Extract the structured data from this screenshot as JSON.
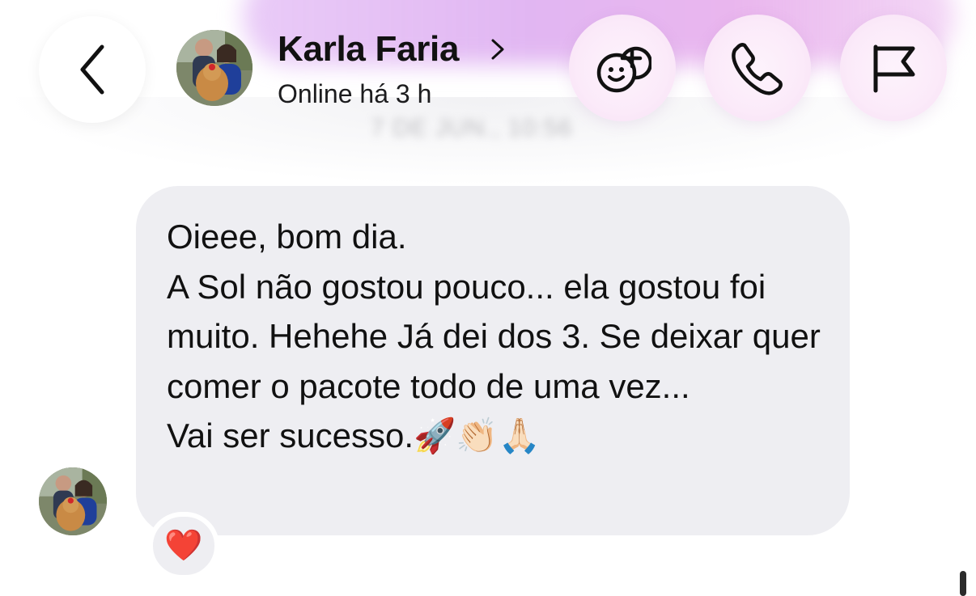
{
  "header": {
    "contact_name": "Karla Faria",
    "status": "Online há 3 h",
    "back_icon": "chevron-left-icon",
    "chevron_icon": "chevron-right-icon",
    "actions": [
      {
        "name": "effects",
        "icon": "smiley-plus-icon"
      },
      {
        "name": "call",
        "icon": "phone-icon"
      },
      {
        "name": "report",
        "icon": "flag-icon"
      }
    ]
  },
  "conversation": {
    "date_divider": "7 DE JUN., 10:56",
    "message": {
      "text": "Oieee, bom dia.\nA Sol não gostou pouco... ela gostou foi muito. Hehehe Já dei dos 3. Se deixar quer comer o pacote todo de uma vez...\nVai ser sucesso.🚀👏🏻🙏🏻",
      "reaction": "❤️"
    }
  },
  "colors": {
    "bubble": "#eeeef2",
    "header_button": "#fbeaf9",
    "header_glow": "#dcaaf0",
    "reaction_heart": "#e0182d"
  }
}
